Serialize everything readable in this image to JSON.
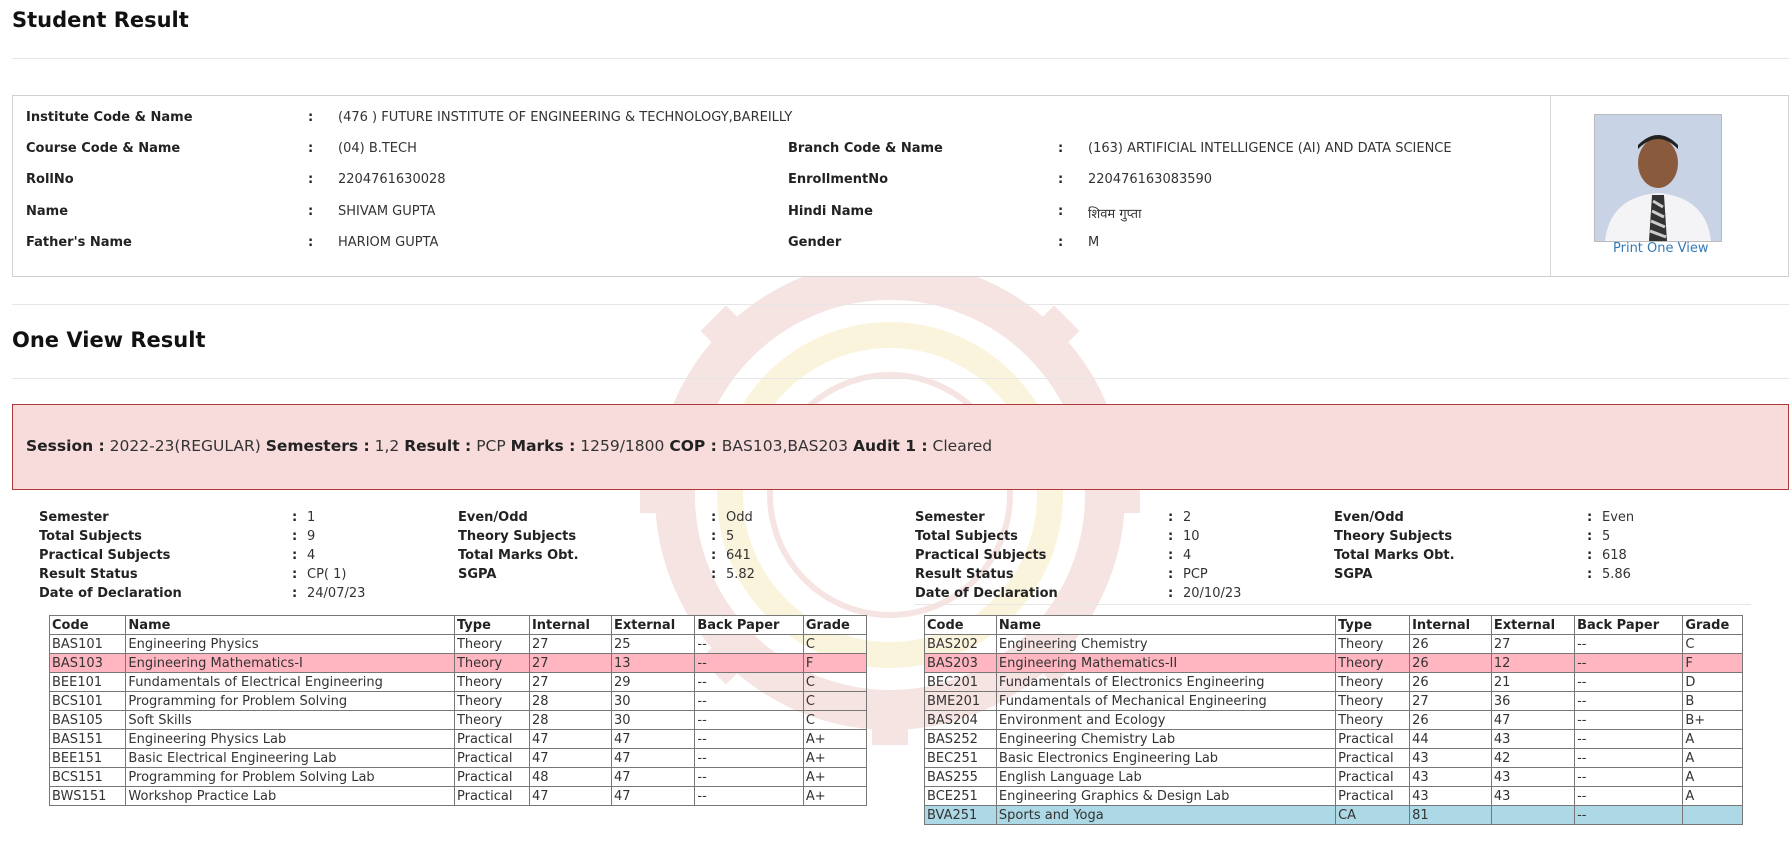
{
  "page_title": "Student Result",
  "section_title": "One View Result",
  "student": {
    "institute_label": "Institute Code & Name",
    "institute_value": "(476 ) FUTURE INSTITUTE OF ENGINEERING & TECHNOLOGY,BAREILLY",
    "course_label": "Course Code & Name",
    "course_value": "(04) B.TECH",
    "branch_label": "Branch Code & Name",
    "branch_value": "(163) ARTIFICIAL INTELLIGENCE (AI) AND DATA SCIENCE",
    "rollno_label": "RollNo",
    "rollno_value": "2204761630028",
    "enrollment_label": "EnrollmentNo",
    "enrollment_value": "220476163083590",
    "name_label": "Name",
    "name_value": "SHIVAM GUPTA",
    "hindi_label": "Hindi Name",
    "hindi_value": "शिवम गुप्ता",
    "father_label": "Father's Name",
    "father_value": "HARIOM GUPTA",
    "gender_label": "Gender",
    "gender_value": "M",
    "colon": ":"
  },
  "print_link": "Print One View",
  "session": {
    "session_label": "Session :",
    "session_value": "2022-23(REGULAR)",
    "semesters_label": "Semesters :",
    "semesters_value": "1,2",
    "result_label": "Result :",
    "result_value": "PCP",
    "marks_label": "Marks :",
    "marks_value": "1259/1800",
    "cop_label": "COP :",
    "cop_value": "BAS103,BAS203",
    "audit_label": "Audit 1 :",
    "audit_value": "Cleared"
  },
  "summary_labels": {
    "semester": "Semester",
    "total_subjects": "Total Subjects",
    "practical_subjects": "Practical Subjects",
    "result_status": "Result Status",
    "date_of_declaration": "Date of Declaration",
    "even_odd": "Even/Odd",
    "theory_subjects": "Theory Subjects",
    "total_marks_obt": "Total Marks Obt.",
    "sgpa": "SGPA",
    "colon": ":"
  },
  "table_headers": [
    "Code",
    "Name",
    "Type",
    "Internal",
    "External",
    "Back Paper",
    "Grade"
  ],
  "semesters": [
    {
      "semester": "1",
      "total_subjects": "9",
      "practical_subjects": "4",
      "result_status": "CP( 1)",
      "date_of_declaration": "24/07/23",
      "even_odd": "Odd",
      "theory_subjects": "5",
      "total_marks_obt": "641",
      "sgpa": "5.82",
      "rows": [
        {
          "code": "BAS101",
          "name": "Engineering Physics",
          "type": "Theory",
          "internal": "27",
          "external": "25",
          "back": "--",
          "grade": "C",
          "status": "normal"
        },
        {
          "code": "BAS103",
          "name": "Engineering Mathematics-I",
          "type": "Theory",
          "internal": "27",
          "external": "13",
          "back": "--",
          "grade": "F",
          "status": "fail"
        },
        {
          "code": "BEE101",
          "name": "Fundamentals of Electrical Engineering",
          "type": "Theory",
          "internal": "27",
          "external": "29",
          "back": "--",
          "grade": "C",
          "status": "normal"
        },
        {
          "code": "BCS101",
          "name": "Programming for Problem Solving",
          "type": "Theory",
          "internal": "28",
          "external": "30",
          "back": "--",
          "grade": "C",
          "status": "normal"
        },
        {
          "code": "BAS105",
          "name": "Soft Skills",
          "type": "Theory",
          "internal": "28",
          "external": "30",
          "back": "--",
          "grade": "C",
          "status": "normal"
        },
        {
          "code": "BAS151",
          "name": "Engineering Physics Lab",
          "type": "Practical",
          "internal": "47",
          "external": "47",
          "back": "--",
          "grade": "A+",
          "status": "normal"
        },
        {
          "code": "BEE151",
          "name": "Basic Electrical Engineering Lab",
          "type": "Practical",
          "internal": "47",
          "external": "47",
          "back": "--",
          "grade": "A+",
          "status": "normal"
        },
        {
          "code": "BCS151",
          "name": "Programming for Problem Solving Lab",
          "type": "Practical",
          "internal": "48",
          "external": "47",
          "back": "--",
          "grade": "A+",
          "status": "normal"
        },
        {
          "code": "BWS151",
          "name": "Workshop Practice Lab",
          "type": "Practical",
          "internal": "47",
          "external": "47",
          "back": "--",
          "grade": "A+",
          "status": "normal"
        }
      ]
    },
    {
      "semester": "2",
      "total_subjects": "10",
      "practical_subjects": "4",
      "result_status": "PCP",
      "date_of_declaration": "20/10/23",
      "even_odd": "Even",
      "theory_subjects": "5",
      "total_marks_obt": "618",
      "sgpa": "5.86",
      "rows": [
        {
          "code": "BAS202",
          "name": "Engineering Chemistry",
          "type": "Theory",
          "internal": "26",
          "external": "27",
          "back": "--",
          "grade": "C",
          "status": "normal"
        },
        {
          "code": "BAS203",
          "name": "Engineering Mathematics-II",
          "type": "Theory",
          "internal": "26",
          "external": "12",
          "back": "--",
          "grade": "F",
          "status": "fail"
        },
        {
          "code": "BEC201",
          "name": "Fundamentals of Electronics Engineering",
          "type": "Theory",
          "internal": "26",
          "external": "21",
          "back": "--",
          "grade": "D",
          "status": "normal"
        },
        {
          "code": "BME201",
          "name": "Fundamentals of Mechanical Engineering",
          "type": "Theory",
          "internal": "27",
          "external": "36",
          "back": "--",
          "grade": "B",
          "status": "normal"
        },
        {
          "code": "BAS204",
          "name": "Environment and Ecology",
          "type": "Theory",
          "internal": "26",
          "external": "47",
          "back": "--",
          "grade": "B+",
          "status": "normal"
        },
        {
          "code": "BAS252",
          "name": "Engineering Chemistry Lab",
          "type": "Practical",
          "internal": "44",
          "external": "43",
          "back": "--",
          "grade": "A",
          "status": "normal"
        },
        {
          "code": "BEC251",
          "name": "Basic Electronics Engineering Lab",
          "type": "Practical",
          "internal": "43",
          "external": "42",
          "back": "--",
          "grade": "A",
          "status": "normal"
        },
        {
          "code": "BAS255",
          "name": "English Language Lab",
          "type": "Practical",
          "internal": "43",
          "external": "43",
          "back": "--",
          "grade": "A",
          "status": "normal"
        },
        {
          "code": "BCE251",
          "name": "Engineering Graphics & Design Lab",
          "type": "Practical",
          "internal": "43",
          "external": "43",
          "back": "--",
          "grade": "A",
          "status": "normal"
        },
        {
          "code": "BVA251",
          "name": "Sports and Yoga",
          "type": "CA",
          "internal": "81",
          "external": "",
          "back": "--",
          "grade": "",
          "status": "ca"
        }
      ]
    }
  ],
  "colors": {
    "fail_row": "#ffb6c1",
    "ca_row": "#add8e6",
    "session_bg": "#f8dcdc",
    "session_border": "#b03a3a",
    "link": "#337ab7"
  }
}
